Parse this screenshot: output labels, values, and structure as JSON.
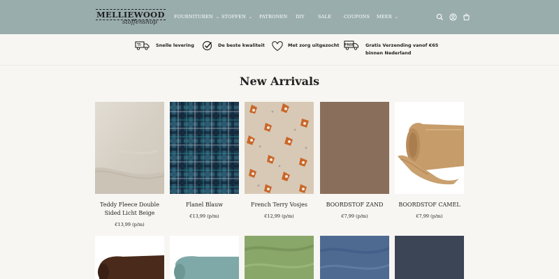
{
  "brand": {
    "name": "MELLIEWOOD",
    "tagline": "stoffenshop"
  },
  "nav": [
    {
      "label": "FOURNITUREN",
      "dropdown": true
    },
    {
      "label": "STOFFEN",
      "dropdown": true
    },
    {
      "label": "PATRONEN",
      "dropdown": false
    },
    {
      "label": "DIY",
      "dropdown": false
    },
    {
      "label": "SALE",
      "dropdown": false
    },
    {
      "label": "COUPONS",
      "dropdown": false
    },
    {
      "label": "MEER",
      "dropdown": true
    }
  ],
  "header_icons": [
    "search-icon",
    "account-icon",
    "cart-icon"
  ],
  "usps": [
    {
      "icon": "delivery-truck-icon",
      "text": "Snelle levering"
    },
    {
      "icon": "check-circle-icon",
      "text": "De beste kwaliteit"
    },
    {
      "icon": "heart-icon",
      "text": "Met zorg uitgezocht"
    },
    {
      "icon": "free-shipping-truck-icon",
      "badge": "FREE",
      "line1": "Gratis Verzending vanof €65",
      "line2": "binnen Nederland"
    }
  ],
  "section": {
    "title": "New Arrivals"
  },
  "products": [
    {
      "name": "Teddy Fleece Double Sided Licht Beige",
      "price": "€13,99 (p/m)",
      "color": "#d9d3c9"
    },
    {
      "name": "Flanel Blauw",
      "price": "€13,99 (p/m)",
      "color": "#1d3a50"
    },
    {
      "name": "French Terry Vosjes",
      "price": "€12,99 (p/m)",
      "color": "#d8c9b6"
    },
    {
      "name": "BOORDSTOF ZAND",
      "price": "€7,99 (p/m)",
      "color": "#8a6e5c"
    },
    {
      "name": "BOORDSTOF CAMEL",
      "price": "€7,99 (p/m)",
      "color": "#c69c6a"
    }
  ],
  "products_row2": [
    {
      "color": "#4a2a1a"
    },
    {
      "color": "#7fa9a8"
    },
    {
      "color": "#8aa76a"
    },
    {
      "color": "#4f6a91"
    },
    {
      "color": "#3c4556"
    }
  ],
  "colors": {
    "header_bg": "#9aadad",
    "page_bg": "#f7f6f2"
  }
}
